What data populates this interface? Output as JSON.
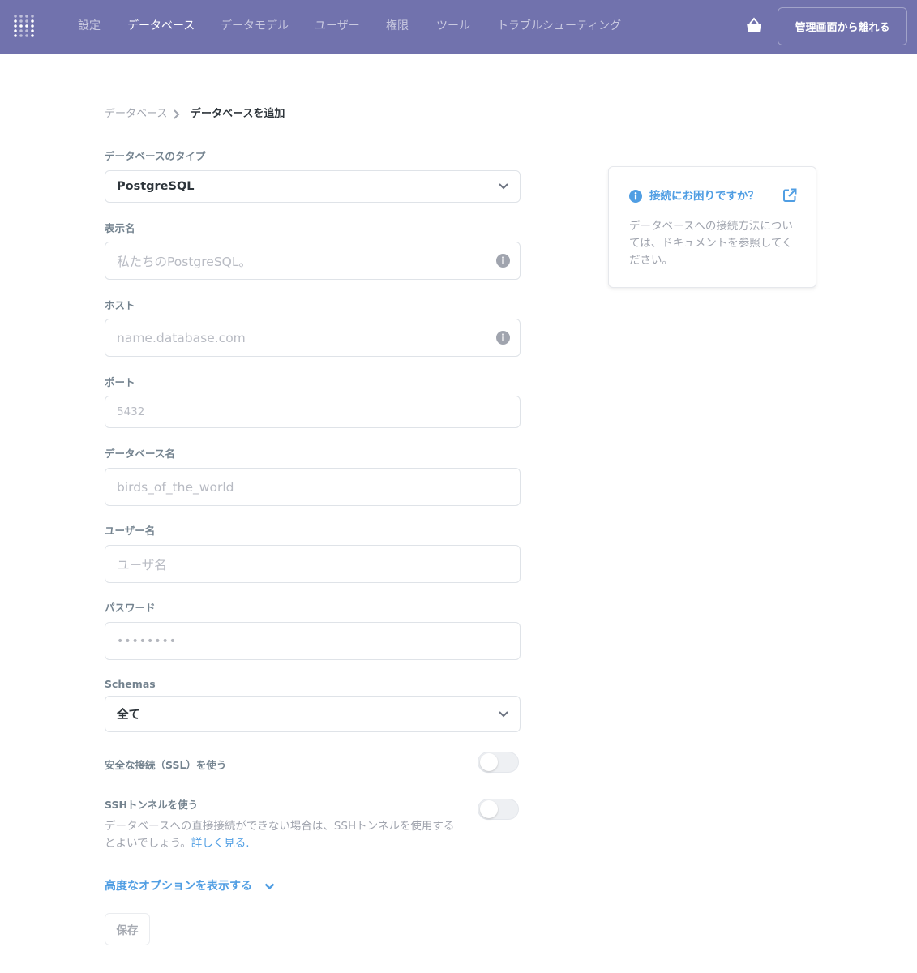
{
  "nav": {
    "items": [
      {
        "label": "設定",
        "active": false
      },
      {
        "label": "データベース",
        "active": true
      },
      {
        "label": "データモデル",
        "active": false
      },
      {
        "label": "ユーザー",
        "active": false
      },
      {
        "label": "権限",
        "active": false
      },
      {
        "label": "ツール",
        "active": false
      },
      {
        "label": "トラブルシューティング",
        "active": false
      }
    ],
    "exit_label": "管理画面から離れる",
    "bg_color": "#7172ad"
  },
  "breadcrumb": {
    "parent": "データベース",
    "current": "データベースを追加"
  },
  "form": {
    "db_type": {
      "label": "データベースのタイプ",
      "value": "PostgreSQL"
    },
    "display_name": {
      "label": "表示名",
      "placeholder": "私たちのPostgreSQL。"
    },
    "host": {
      "label": "ホスト",
      "placeholder": "name.database.com"
    },
    "port": {
      "label": "ポート",
      "placeholder": "5432"
    },
    "db_name": {
      "label": "データベース名",
      "placeholder": "birds_of_the_world"
    },
    "username": {
      "label": "ユーザー名",
      "placeholder": "ユーザ名"
    },
    "password": {
      "label": "パスワード",
      "placeholder": "••••••••"
    },
    "schemas": {
      "label": "Schemas",
      "value": "全て"
    },
    "ssl": {
      "label": "安全な接続（SSL）を使う",
      "enabled": false
    },
    "ssh": {
      "label": "SSHトンネルを使う",
      "enabled": false,
      "help": "データベースへの直接接続ができない場合は、SSHトンネルを使用するとよいでしょう。",
      "help_link": "詳しく見る."
    },
    "advanced_label": "高度なオプションを表示する",
    "save_label": "保存"
  },
  "help_card": {
    "title": "接続にお困りですか？",
    "body": "データベースへの接続方法については、ドキュメントを参照してください。"
  },
  "colors": {
    "accent": "#509ee3",
    "nav": "#7172ad"
  }
}
